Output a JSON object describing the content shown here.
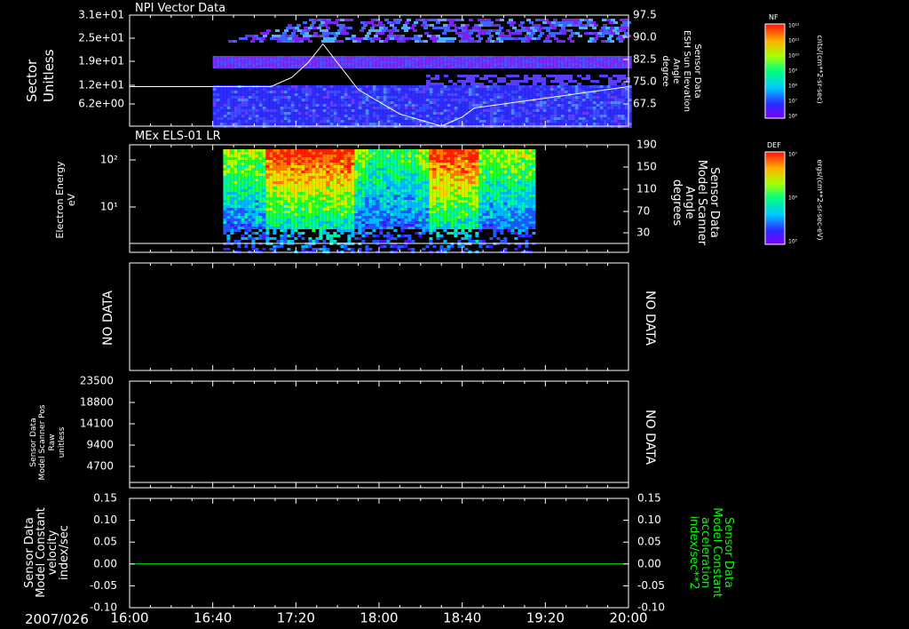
{
  "footer": {
    "date": "2007/026",
    "time_ticks": [
      "16:00",
      "16:40",
      "17:20",
      "18:00",
      "18:40",
      "19:20",
      "20:00"
    ]
  },
  "panels": {
    "npi": {
      "title": "NPI Vector Data",
      "ylabel": [
        "Sector",
        "Unitless"
      ],
      "left_ticks": [
        "3.1e+01",
        "2.5e+01",
        "1.9e+01",
        "1.2e+01",
        "6.2e+00"
      ],
      "right_ticks": [
        "97.5",
        "90.0",
        "82.5",
        "75.0",
        "67.5"
      ],
      "right_label": [
        "Sensor Data",
        "ESH Sun Elevation",
        "Angle",
        "degree"
      ],
      "colorbar": {
        "label": "NF",
        "ticks": [
          "10¹²",
          "10¹¹",
          "10¹⁰",
          "10⁹",
          "10⁸",
          "10⁷",
          "10⁶"
        ],
        "units": "cnts/(cm**2-sr-sec)"
      }
    },
    "els": {
      "title": "MEx ELS-01 LR",
      "ylabel": [
        "Electron Energy",
        "eV"
      ],
      "left_ticks": [
        "10²",
        "10¹"
      ],
      "right_ticks": [
        "190",
        "150",
        "110",
        "70",
        "30"
      ],
      "right_label": [
        "Sensor Data",
        "Model Scanner",
        "Angle",
        "degrees"
      ],
      "colorbar": {
        "label": "DEF",
        "ticks": [
          "10⁷",
          "10⁶",
          "10⁵"
        ],
        "units": "ergs/(cm**2-sr-sec-eV)"
      }
    },
    "nodata": {
      "left_text": "NO DATA",
      "right_text": "NO DATA"
    },
    "scanner_pos": {
      "ylabel": [
        "Sensor Data",
        "Model Scanner Pos",
        "Raw",
        "unitless"
      ],
      "left_ticks": [
        "23500",
        "18800",
        "14100",
        "9400",
        "4700"
      ],
      "right_text": "NO DATA"
    },
    "velocity": {
      "ylabel": [
        "Sensor Data",
        "Model Constant",
        "velocity",
        "index/sec"
      ],
      "left_ticks": [
        "0.15",
        "0.10",
        "0.05",
        "0.00",
        "-0.05",
        "-0.10"
      ],
      "right_ticks": [
        "0.15",
        "0.10",
        "0.05",
        "0.00",
        "-0.05",
        "-0.10"
      ],
      "right_label": [
        "Sensor Data",
        "Model Constant",
        "acceleration",
        "index/sec**2"
      ]
    }
  },
  "colors": {
    "background": "#000000",
    "axes": "#ffffff",
    "acceleration_trace": "#00ff00"
  },
  "chart_data": [
    {
      "type": "heatmap",
      "title": "NPI Vector Data",
      "ylabel": "Sector Unitless",
      "xlim": [
        "16:00",
        "20:00"
      ],
      "ylim": [
        0,
        32
      ],
      "data_start": "16:40",
      "data_end": "20:00",
      "colorscale": "log",
      "colorbar_range": [
        1000000.0,
        1000000000000.0
      ],
      "overlay": {
        "name": "Sensor Data ESH Sun Elevation Angle",
        "units": "degree",
        "ylim": [
          61,
          97.5
        ],
        "x": [
          "16:00",
          "17:08",
          "17:18",
          "17:26",
          "17:33",
          "17:50",
          "18:10",
          "18:30",
          "18:40",
          "18:46",
          "20:00"
        ],
        "y": [
          74,
          74,
          77,
          82,
          88,
          73,
          65,
          61,
          64,
          67,
          74
        ]
      }
    },
    {
      "type": "heatmap",
      "title": "MEx ELS-01 LR",
      "ylabel": "Electron Energy eV",
      "yscale": "log",
      "ylim": [
        1,
        200
      ],
      "xlim": [
        "16:00",
        "20:00"
      ],
      "data_start": "16:45",
      "data_end": "19:14",
      "colorscale": "log",
      "colorbar_range": [
        100000.0,
        10000000.0
      ],
      "overlay": {
        "name": "Sensor Data Model Scanner Angle",
        "units": "degrees",
        "ylim": [
          0,
          190
        ],
        "x": [
          "16:00",
          "20:00"
        ],
        "y": [
          10,
          10
        ]
      }
    },
    {
      "type": "line",
      "ylabel": "Sensor Data Model Scanner Pos Raw unitless",
      "ylim": [
        0,
        23500
      ],
      "xlim": [
        "16:00",
        "20:00"
      ],
      "series": []
    },
    {
      "type": "line",
      "ylabel": "Sensor Data Model Constant velocity index/sec",
      "ylim": [
        -0.1,
        0.15
      ],
      "xlim": [
        "16:00",
        "20:00"
      ],
      "series": [
        {
          "name": "Sensor Data Model Constant acceleration index/sec**2",
          "x": [
            "16:00",
            "20:00"
          ],
          "y": [
            0,
            0
          ]
        }
      ]
    }
  ]
}
